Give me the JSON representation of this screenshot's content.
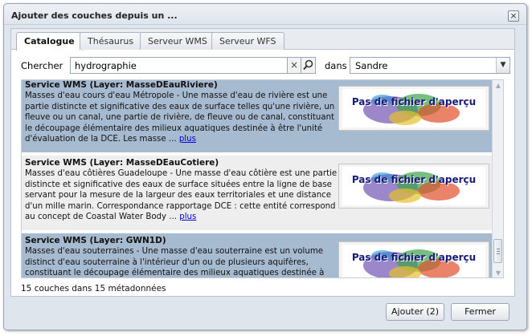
{
  "window": {
    "title": "Ajouter des couches depuis un ...",
    "close_icon": "close-icon"
  },
  "tabs": [
    {
      "label": "Catalogue",
      "active": true
    },
    {
      "label": "Thésaurus",
      "active": false
    },
    {
      "label": "Serveur WMS",
      "active": false
    },
    {
      "label": "Serveur WFS",
      "active": false
    }
  ],
  "search": {
    "label": "Chercher",
    "value": "hydrographie",
    "clear_glyph": "×",
    "in_label": "dans",
    "catalog_selected": "Sandre"
  },
  "results": [
    {
      "title": "Service WMS (Layer: MasseDEauRiviere)",
      "description": "Masses d'eau cours d'eau Métropole - Une masse d'eau de rivière est une partie distincte et significative des eaux de surface telles qu'une rivière, un fleuve ou un canal, une partie de rivière, de fleuve ou de canal, constituant le découpage élémentaire des milieux aquatiques destinée à être l'unité d'évaluation de la DCE. Les masse ...",
      "more_label": "plus",
      "thumbnail_text": "Pas de fichier d'aperçu",
      "selected": true
    },
    {
      "title": "Service WMS (Layer: MasseDEauCotiere)",
      "description": "Masses d'eau côtières Guadeloupe - Une masse d'eau côtière est une partie distincte et significative des eaux de surface situées entre la ligne de base servant pour la mesure de la largeur des eaux territoriales et une distance d'un mille marin. Correspondance rapportage DCE : cette entité correspond au concept de Coastal Water Body ...",
      "more_label": "plus",
      "thumbnail_text": "Pas de fichier d'aperçu",
      "selected": false
    },
    {
      "title": "Service WMS (Layer: GWN1D)",
      "description": "Masses d'eau souterraines - Une masse d'eau souterraine est un volume distinct d'eau souterraine à l'intérieur d'un ou de plusieurs aquifères, constituant le découpage élémentaire des milieux aquatiques destinée à être l'unité d'évaluation",
      "more_label": "",
      "thumbnail_text": "Pas de fichier d'aperçu",
      "selected": true
    }
  ],
  "status": "15 couches dans 15 métadonnées",
  "footer": {
    "add_label": "Ajouter (2)",
    "close_label": "Fermer"
  }
}
